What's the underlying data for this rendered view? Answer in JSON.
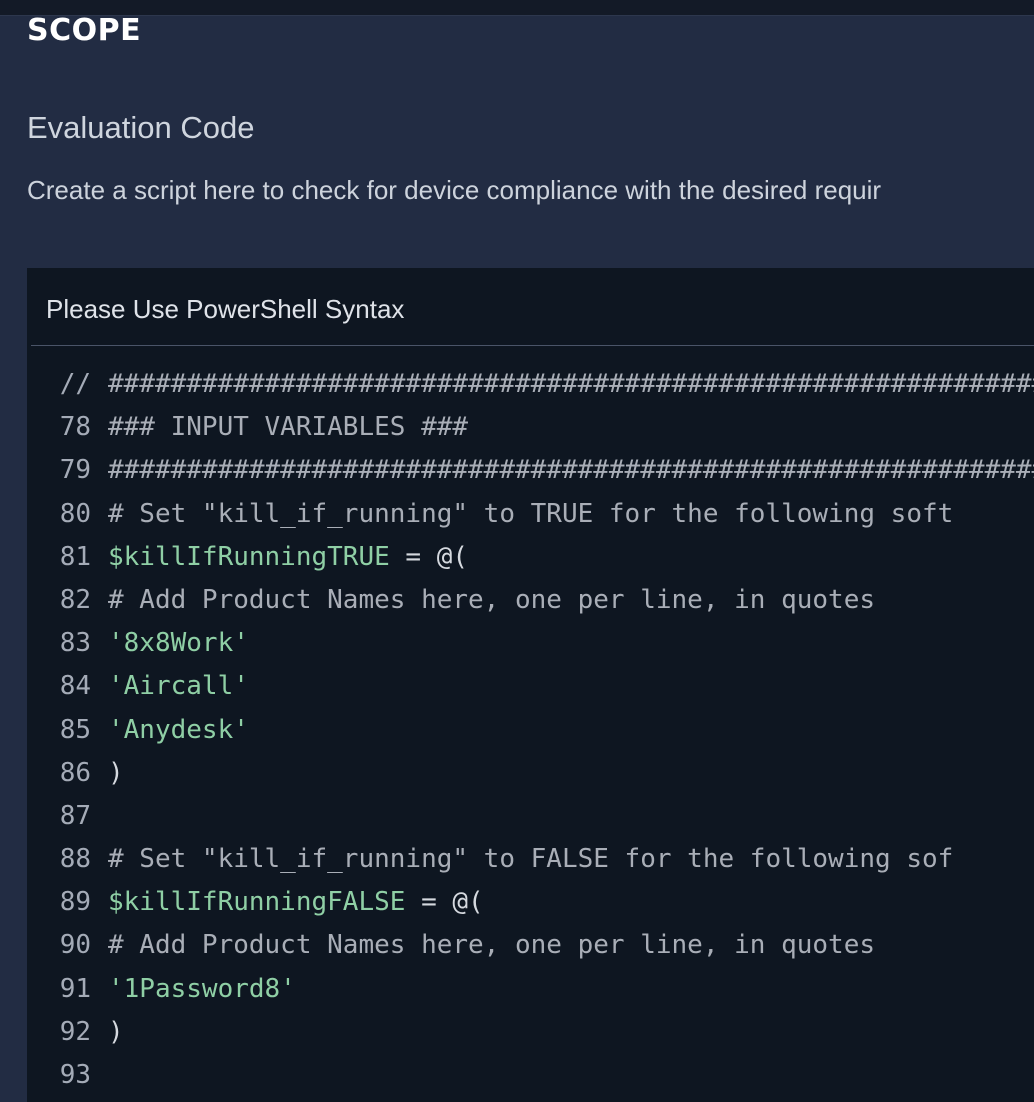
{
  "scope_heading": "SCOPE",
  "section": {
    "title": "Evaluation Code",
    "description": "Create a script here to check for device compliance with the desired requir"
  },
  "editor": {
    "header": "Please Use PowerShell Syntax",
    "lines": [
      {
        "number": "//",
        "kind": "comment",
        "text": "################################################################",
        "suffix": ""
      },
      {
        "number": "78",
        "kind": "comment",
        "text": "### INPUT VARIABLES ###",
        "suffix": ""
      },
      {
        "number": "79",
        "kind": "comment",
        "text": "################################################################",
        "suffix": ""
      },
      {
        "number": "80",
        "kind": "comment",
        "text": "# Set \"kill_if_running\" to TRUE for the following soft",
        "suffix": ""
      },
      {
        "number": "81",
        "kind": "variable",
        "text": "$killIfRunningTRUE",
        "suffix": " = @("
      },
      {
        "number": "82",
        "kind": "comment",
        "text": "# Add Product Names here, one per line, in quotes",
        "suffix": ""
      },
      {
        "number": "83",
        "kind": "string",
        "text": "'8x8Work'",
        "suffix": ""
      },
      {
        "number": "84",
        "kind": "string",
        "text": "'Aircall'",
        "suffix": ""
      },
      {
        "number": "85",
        "kind": "string",
        "text": "'Anydesk'",
        "suffix": ""
      },
      {
        "number": "86",
        "kind": "plain",
        "text": ")",
        "suffix": ""
      },
      {
        "number": "87",
        "kind": "plain",
        "text": "",
        "suffix": ""
      },
      {
        "number": "88",
        "kind": "comment",
        "text": "# Set \"kill_if_running\" to FALSE for the following sof",
        "suffix": ""
      },
      {
        "number": "89",
        "kind": "variable",
        "text": "$killIfRunningFALSE",
        "suffix": " = @("
      },
      {
        "number": "90",
        "kind": "comment",
        "text": "# Add Product Names here, one per line, in quotes",
        "suffix": ""
      },
      {
        "number": "91",
        "kind": "string",
        "text": "'1Password8'",
        "suffix": ""
      },
      {
        "number": "92",
        "kind": "plain",
        "text": ")",
        "suffix": ""
      },
      {
        "number": "93",
        "kind": "plain",
        "text": "",
        "suffix": ""
      }
    ]
  }
}
